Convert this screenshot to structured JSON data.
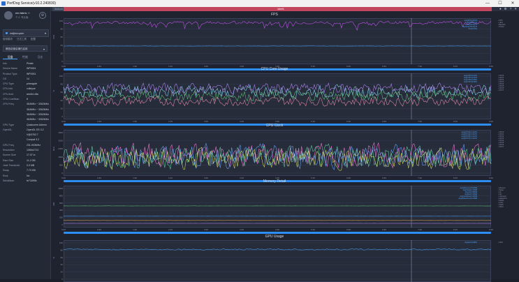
{
  "window": {
    "title": "PerfDog Service(v10.2.240830)",
    "controls": [
      "—",
      "☐",
      "✕"
    ]
  },
  "sidebar": {
    "user": {
      "name": "eer.fabric ☆",
      "sub": "个人 专业版"
    },
    "device": "vsfjinnopen",
    "nav": [
      "使用模块",
      "日志工具",
      "配置"
    ],
    "app": "微信自营店铺已启用",
    "tabs": [
      "设备",
      "性能",
      "日志"
    ],
    "info": [
      {
        "k": "Info",
        "v": "Pixlab"
      },
      {
        "k": "Device Name",
        "v": "WP0001"
      },
      {
        "k": "Product Type",
        "v": "WP0001"
      },
      {
        "k": "OS",
        "v": "14"
      },
      {
        "k": "CPU Type",
        "v": "pineapple"
      },
      {
        "k": "CPU Info",
        "v": "volleyoe"
      },
      {
        "k": "CPU Arch",
        "v": "arm64-v8a"
      },
      {
        "k": "CPU CoreNum",
        "v": "8"
      },
      {
        "k": "CPU Freq",
        "v": "364MHz ~ 3302MHz"
      },
      {
        "k": "",
        "v": "364MHz ~ 3302MHz"
      },
      {
        "k": "",
        "v": "364MHz ~ 3302MHz"
      },
      {
        "k": "",
        "v": "364MHz ~ 3302MHz"
      },
      {
        "k": "GPU Type",
        "v": "Qualcomm Adreno"
      },
      {
        "k": "OpenGL",
        "v": "OpenGL ES 3.2"
      },
      {
        "k": "",
        "v": "V@0762.7"
      },
      {
        "k": "",
        "v": "Compat 3.2"
      },
      {
        "k": "GPU Freq",
        "v": "231-903MHz"
      },
      {
        "k": "Resolution",
        "v": "1080x2712"
      },
      {
        "k": "Screen Size",
        "v": "17.37 in"
      },
      {
        "k": "Ram Size",
        "v": "11.2 GB"
      },
      {
        "k": "Jank Threshold",
        "v": "0.0 MB"
      },
      {
        "k": "Swap",
        "v": "7.73 GB"
      },
      {
        "k": "Root",
        "v": "No"
      },
      {
        "k": "SerialNum",
        "v": "fe71890b"
      }
    ]
  },
  "main": {
    "tag": "Android",
    "header_label": "label1",
    "icons": [
      "●",
      "⚙",
      "?",
      "✕"
    ]
  },
  "panels": [
    {
      "title": "FPS",
      "ylabel": "FPS",
      "yticks": [
        "100",
        "80",
        "60",
        "40",
        "20",
        "0"
      ],
      "times": [
        "0:00",
        "0:45",
        "1:30",
        "2:15",
        "3:00",
        "3:45",
        "4:30",
        "5:15",
        "6:00",
        "6:45",
        "7:30",
        "8:15",
        "9:00"
      ],
      "legend_right": [
        "FPS",
        "Jank",
        "BigJank",
        "Stutter"
      ],
      "legend_in": [
        "Avg(FPS)=119.8",
        "Var(FPS)=1.2",
        "Jank(/10min)=0",
        "BigJank(/10min)=0",
        "Stutter=0%"
      ],
      "series": [
        {
          "name": "FPS",
          "color": "#d155ff",
          "level": 0.96,
          "noise": 0.04,
          "spikes": 0.12
        },
        {
          "name": "Jank",
          "color": "#4ea6ff",
          "level": 0.38,
          "noise": 0.004,
          "spikes": 0
        }
      ]
    },
    {
      "title": "CPU Core Usage",
      "ylabel": "%",
      "yticks": [
        "100",
        "80",
        "60",
        "40",
        "20",
        "0"
      ],
      "times": [
        "0:00",
        "0:45",
        "1:30",
        "2:15",
        "3:00",
        "3:45",
        "4:30",
        "5:15",
        "6:00",
        "6:45",
        "7:30",
        "8:15",
        "9:00"
      ],
      "legend_right": [
        "CPU0",
        "CPU1",
        "CPU2",
        "CPU3",
        "CPU4",
        "CPU5",
        "CPU6",
        "CPU7"
      ],
      "legend_in": [
        "Avg(CPU0)=42%",
        "Avg(CPU1)=40%",
        "Avg(CPU2)=35%",
        "Avg(CPU3)=38%"
      ],
      "series": [
        {
          "name": "CPU0",
          "color": "#8fe3ff",
          "level": 0.62,
          "noise": 0.18,
          "spikes": 0
        },
        {
          "name": "CPU1",
          "color": "#63c77b",
          "level": 0.52,
          "noise": 0.16,
          "spikes": 0
        },
        {
          "name": "CPU2",
          "color": "#f08fb0",
          "level": 0.38,
          "noise": 0.14,
          "spikes": 0
        },
        {
          "name": "CPU3",
          "color": "#b98cff",
          "level": 0.7,
          "noise": 0.15,
          "spikes": 0
        }
      ]
    },
    {
      "title": "CPU Clock",
      "ylabel": "MHz",
      "yticks": [
        "4000",
        "3200",
        "2400",
        "1600",
        "800",
        "0"
      ],
      "times": [
        "0:00",
        "0:45",
        "1:30",
        "2:15",
        "3:00",
        "3:45",
        "4:30",
        "5:15",
        "6:00",
        "6:45",
        "7:30",
        "8:15",
        "9:00"
      ],
      "legend_right": [
        "CPU0",
        "CPU1",
        "CPU2",
        "CPU3",
        "CPU4",
        "CPU5",
        "CPU6",
        "CPU7"
      ],
      "legend_in": [
        "Avg(CPU0)=1.4GHz",
        "Avg(CPU2)=1.6GHz",
        "Avg(CPU5)=1.2GHz",
        "Avg(CPU7)=1.9GHz"
      ],
      "series": [
        {
          "name": "CPU0",
          "color": "#ff7ad9",
          "level": 0.45,
          "noise": 0.35,
          "spikes": 0
        },
        {
          "name": "CPU2",
          "color": "#5fd3a0",
          "level": 0.4,
          "noise": 0.35,
          "spikes": 0
        },
        {
          "name": "CPU5",
          "color": "#6aa8ff",
          "level": 0.42,
          "noise": 0.35,
          "spikes": 0
        },
        {
          "name": "CPU7",
          "color": "#d9e36b",
          "level": 0.35,
          "noise": 0.3,
          "spikes": 0
        }
      ]
    },
    {
      "title": "Memory Detail",
      "ylabel": "MB",
      "yticks": [
        "1000",
        "800",
        "600",
        "400",
        "200",
        "0"
      ],
      "times": [
        "0:00",
        "0:45",
        "1:30",
        "2:15",
        "3:00",
        "3:45",
        "4:30",
        "5:15",
        "6:00",
        "6:45",
        "7:30",
        "8:15",
        "9:00"
      ],
      "legend_right": [
        "Memory",
        "Swap",
        "GL",
        "Gfx",
        "Unknown",
        "NativePss",
        "Dalvik",
        "Code",
        "Stack",
        "Other"
      ],
      "legend_in": [
        "Avg(Memory)=512MB",
        "Avg(Swap)=12MB",
        "Avg(GL)=88MB",
        "Avg(Gfx)=20MB",
        "Avg(Unknown)=40MB",
        "Avg(NativePss)=120MB"
      ],
      "series": [
        {
          "name": "Memory",
          "color": "#63c77b",
          "level": 0.52,
          "noise": 0.003,
          "spikes": 0
        },
        {
          "name": "NativePss",
          "color": "#4ea6ff",
          "level": 0.24,
          "noise": 0.002,
          "spikes": 0
        },
        {
          "name": "GL",
          "color": "#e0a050",
          "level": 0.12,
          "noise": 0.002,
          "spikes": 0
        },
        {
          "name": "Swap",
          "color": "#b98cff",
          "level": 0.04,
          "noise": 0.001,
          "spikes": 0
        }
      ]
    },
    {
      "title": "GPU Usage",
      "ylabel": "%",
      "yticks": [
        "100",
        "80",
        "60",
        "40",
        "20",
        "0"
      ],
      "times": [],
      "legend_right": [
        "GPU"
      ],
      "legend_in": [
        "Avg(GPU)=88%"
      ],
      "series": [
        {
          "name": "GPU",
          "color": "#4ea6ff",
          "level": 0.82,
          "noise": 0.02,
          "spikes": 0
        }
      ]
    }
  ]
}
